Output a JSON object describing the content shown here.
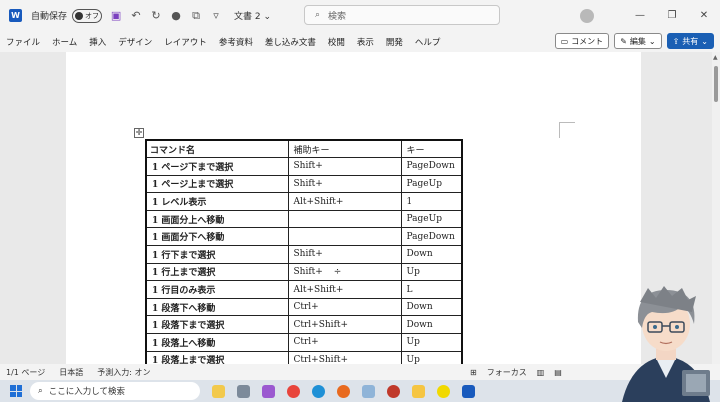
{
  "titlebar": {
    "autosave_label": "自動保存",
    "autosave_state": "オフ",
    "document_title": "文書 2",
    "title_suffix": "⌄",
    "search_placeholder": "検索"
  },
  "menubar": {
    "items": [
      "ファイル",
      "ホーム",
      "挿入",
      "デザイン",
      "レイアウト",
      "参考資料",
      "差し込み文書",
      "校閲",
      "表示",
      "開発",
      "ヘルプ"
    ],
    "comment_label": "コメント",
    "edit_label": "編集",
    "share_label": "共有"
  },
  "table": {
    "headers": [
      "コマンド名",
      "補助キー",
      "キー"
    ],
    "rows": [
      [
        "1 ページ下まで選択",
        "Shift+",
        "PageDown"
      ],
      [
        "1 ページ上まで選択",
        "Shift+",
        "PageUp"
      ],
      [
        "1 レベル表示",
        "Alt+Shift+",
        "1"
      ],
      [
        "1 画面分上へ移動",
        "",
        "PageUp"
      ],
      [
        "1 画面分下へ移動",
        "",
        "PageDown"
      ],
      [
        "1 行下まで選択",
        "Shift+",
        "Down"
      ],
      [
        "1 行上まで選択",
        "Shift+",
        "Up"
      ],
      [
        "1 行目のみ表示",
        "Alt+Shift+",
        "L"
      ],
      [
        "1 段落下へ移動",
        "Ctrl+",
        "Down"
      ],
      [
        "1 段落下まで選択",
        "Ctrl+Shift+",
        "Down"
      ],
      [
        "1 段落上へ移動",
        "Ctrl+",
        "Up"
      ],
      [
        "1 段落上まで選択",
        "Ctrl+Shift+",
        "Up"
      ]
    ]
  },
  "statusbar": {
    "page": "1/1 ページ",
    "language": "日本語",
    "predictive": "予測入力: オン",
    "focus": "フォーカス"
  },
  "taskbar": {
    "search_placeholder": "ここに入力して検索"
  },
  "colors": {
    "accent": "#185abd",
    "share_button": "#1a5fb4"
  }
}
